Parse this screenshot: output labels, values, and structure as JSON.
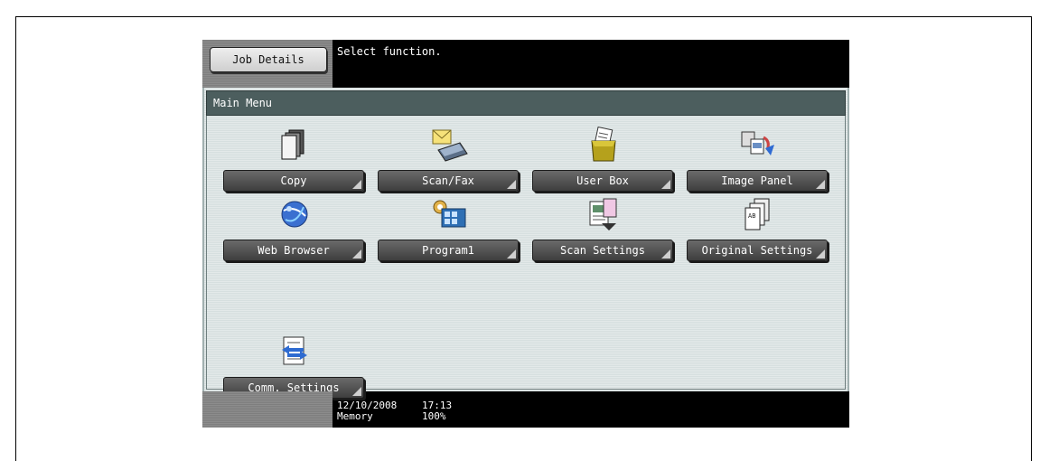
{
  "header": {
    "job_details_label": "Job Details",
    "message": "Select function."
  },
  "panel": {
    "title": "Main Menu"
  },
  "functions": [
    {
      "label": "Copy",
      "icon": "copy-icon"
    },
    {
      "label": "Scan/Fax",
      "icon": "scan-fax-icon"
    },
    {
      "label": "User Box",
      "icon": "user-box-icon"
    },
    {
      "label": "Image Panel",
      "icon": "image-panel-icon"
    },
    {
      "label": "Web Browser",
      "icon": "web-browser-icon"
    },
    {
      "label": "Program1",
      "icon": "program-icon"
    },
    {
      "label": "Scan Settings",
      "icon": "scan-settings-icon"
    },
    {
      "label": "Original Settings",
      "icon": "original-settings-icon"
    },
    {
      "label": "Comm. Settings",
      "icon": "comm-settings-icon"
    }
  ],
  "footer": {
    "date": "12/10/2008",
    "time": "17:13",
    "memory_label": "Memory",
    "memory_value": "100%"
  }
}
